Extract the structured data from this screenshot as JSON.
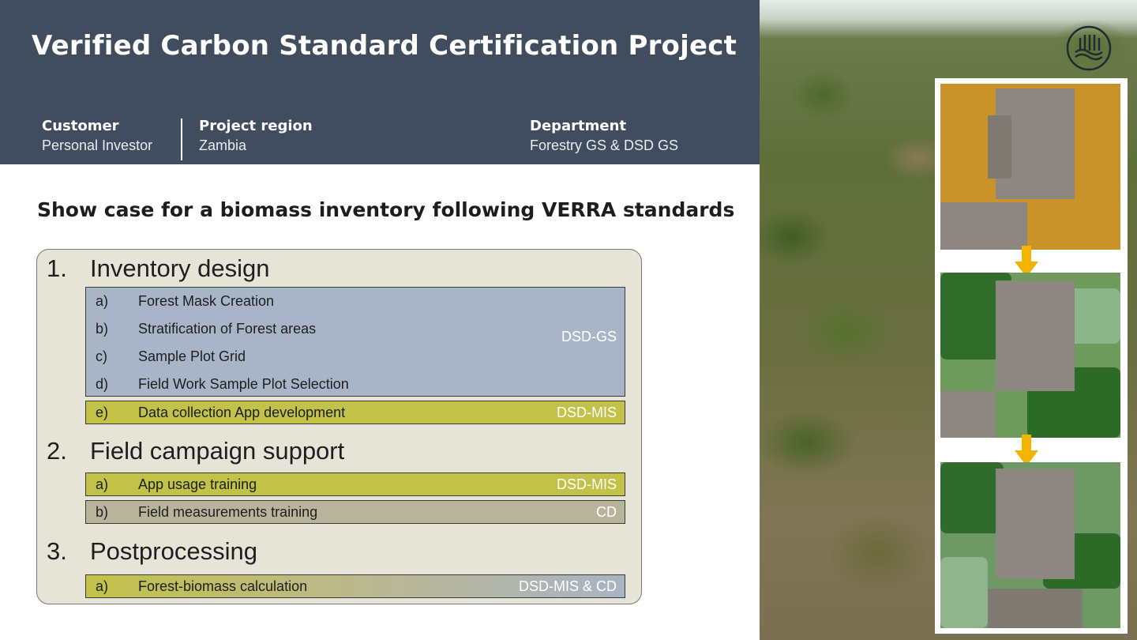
{
  "header": {
    "title": "Verified Carbon Standard Certification Project",
    "customer": {
      "label": "Customer",
      "value": "Personal Investor"
    },
    "region": {
      "label": "Project region",
      "value": "Zambia"
    },
    "department": {
      "label": "Department",
      "value": "Forestry GS & DSD GS"
    }
  },
  "subtitle": "Show case for a biomass inventory following VERRA standards",
  "steps": [
    {
      "number": "1.",
      "title": "Inventory design",
      "groups": [
        {
          "tag": "DSD-GS",
          "color": "#a8b5c7",
          "items": [
            {
              "letter": "a)",
              "text": "Forest Mask Creation"
            },
            {
              "letter": "b)",
              "text": "Stratification of Forest areas"
            },
            {
              "letter": "c)",
              "text": "Sample Plot Grid"
            },
            {
              "letter": "d)",
              "text": "Field Work Sample Plot Selection"
            }
          ]
        },
        {
          "tag": "DSD-MIS",
          "color": "#c3c248",
          "items": [
            {
              "letter": "e)",
              "text": "Data collection App development"
            }
          ]
        }
      ]
    },
    {
      "number": "2.",
      "title": "Field campaign support",
      "groups": [
        {
          "tag": "DSD-MIS",
          "color": "#c3c248",
          "items": [
            {
              "letter": "a)",
              "text": "App usage training"
            }
          ]
        },
        {
          "tag": "CD",
          "color": "#b8b49b",
          "items": [
            {
              "letter": "b)",
              "text": "Field measurements training"
            }
          ]
        }
      ]
    },
    {
      "number": "3.",
      "title": "Postprocessing",
      "groups": [
        {
          "tag": "DSD-MIS & CD",
          "color": "gradient",
          "items": [
            {
              "letter": "a)",
              "text": "Forest-biomass calculation"
            }
          ]
        }
      ]
    }
  ],
  "colors": {
    "header_bg": "#3f4d5f",
    "panel_bg": "#e6e4d7",
    "accent_arrow": "#f2b400"
  },
  "icons": {
    "logo": "company-wave-logo-icon",
    "arrow": "arrow-down-icon"
  }
}
